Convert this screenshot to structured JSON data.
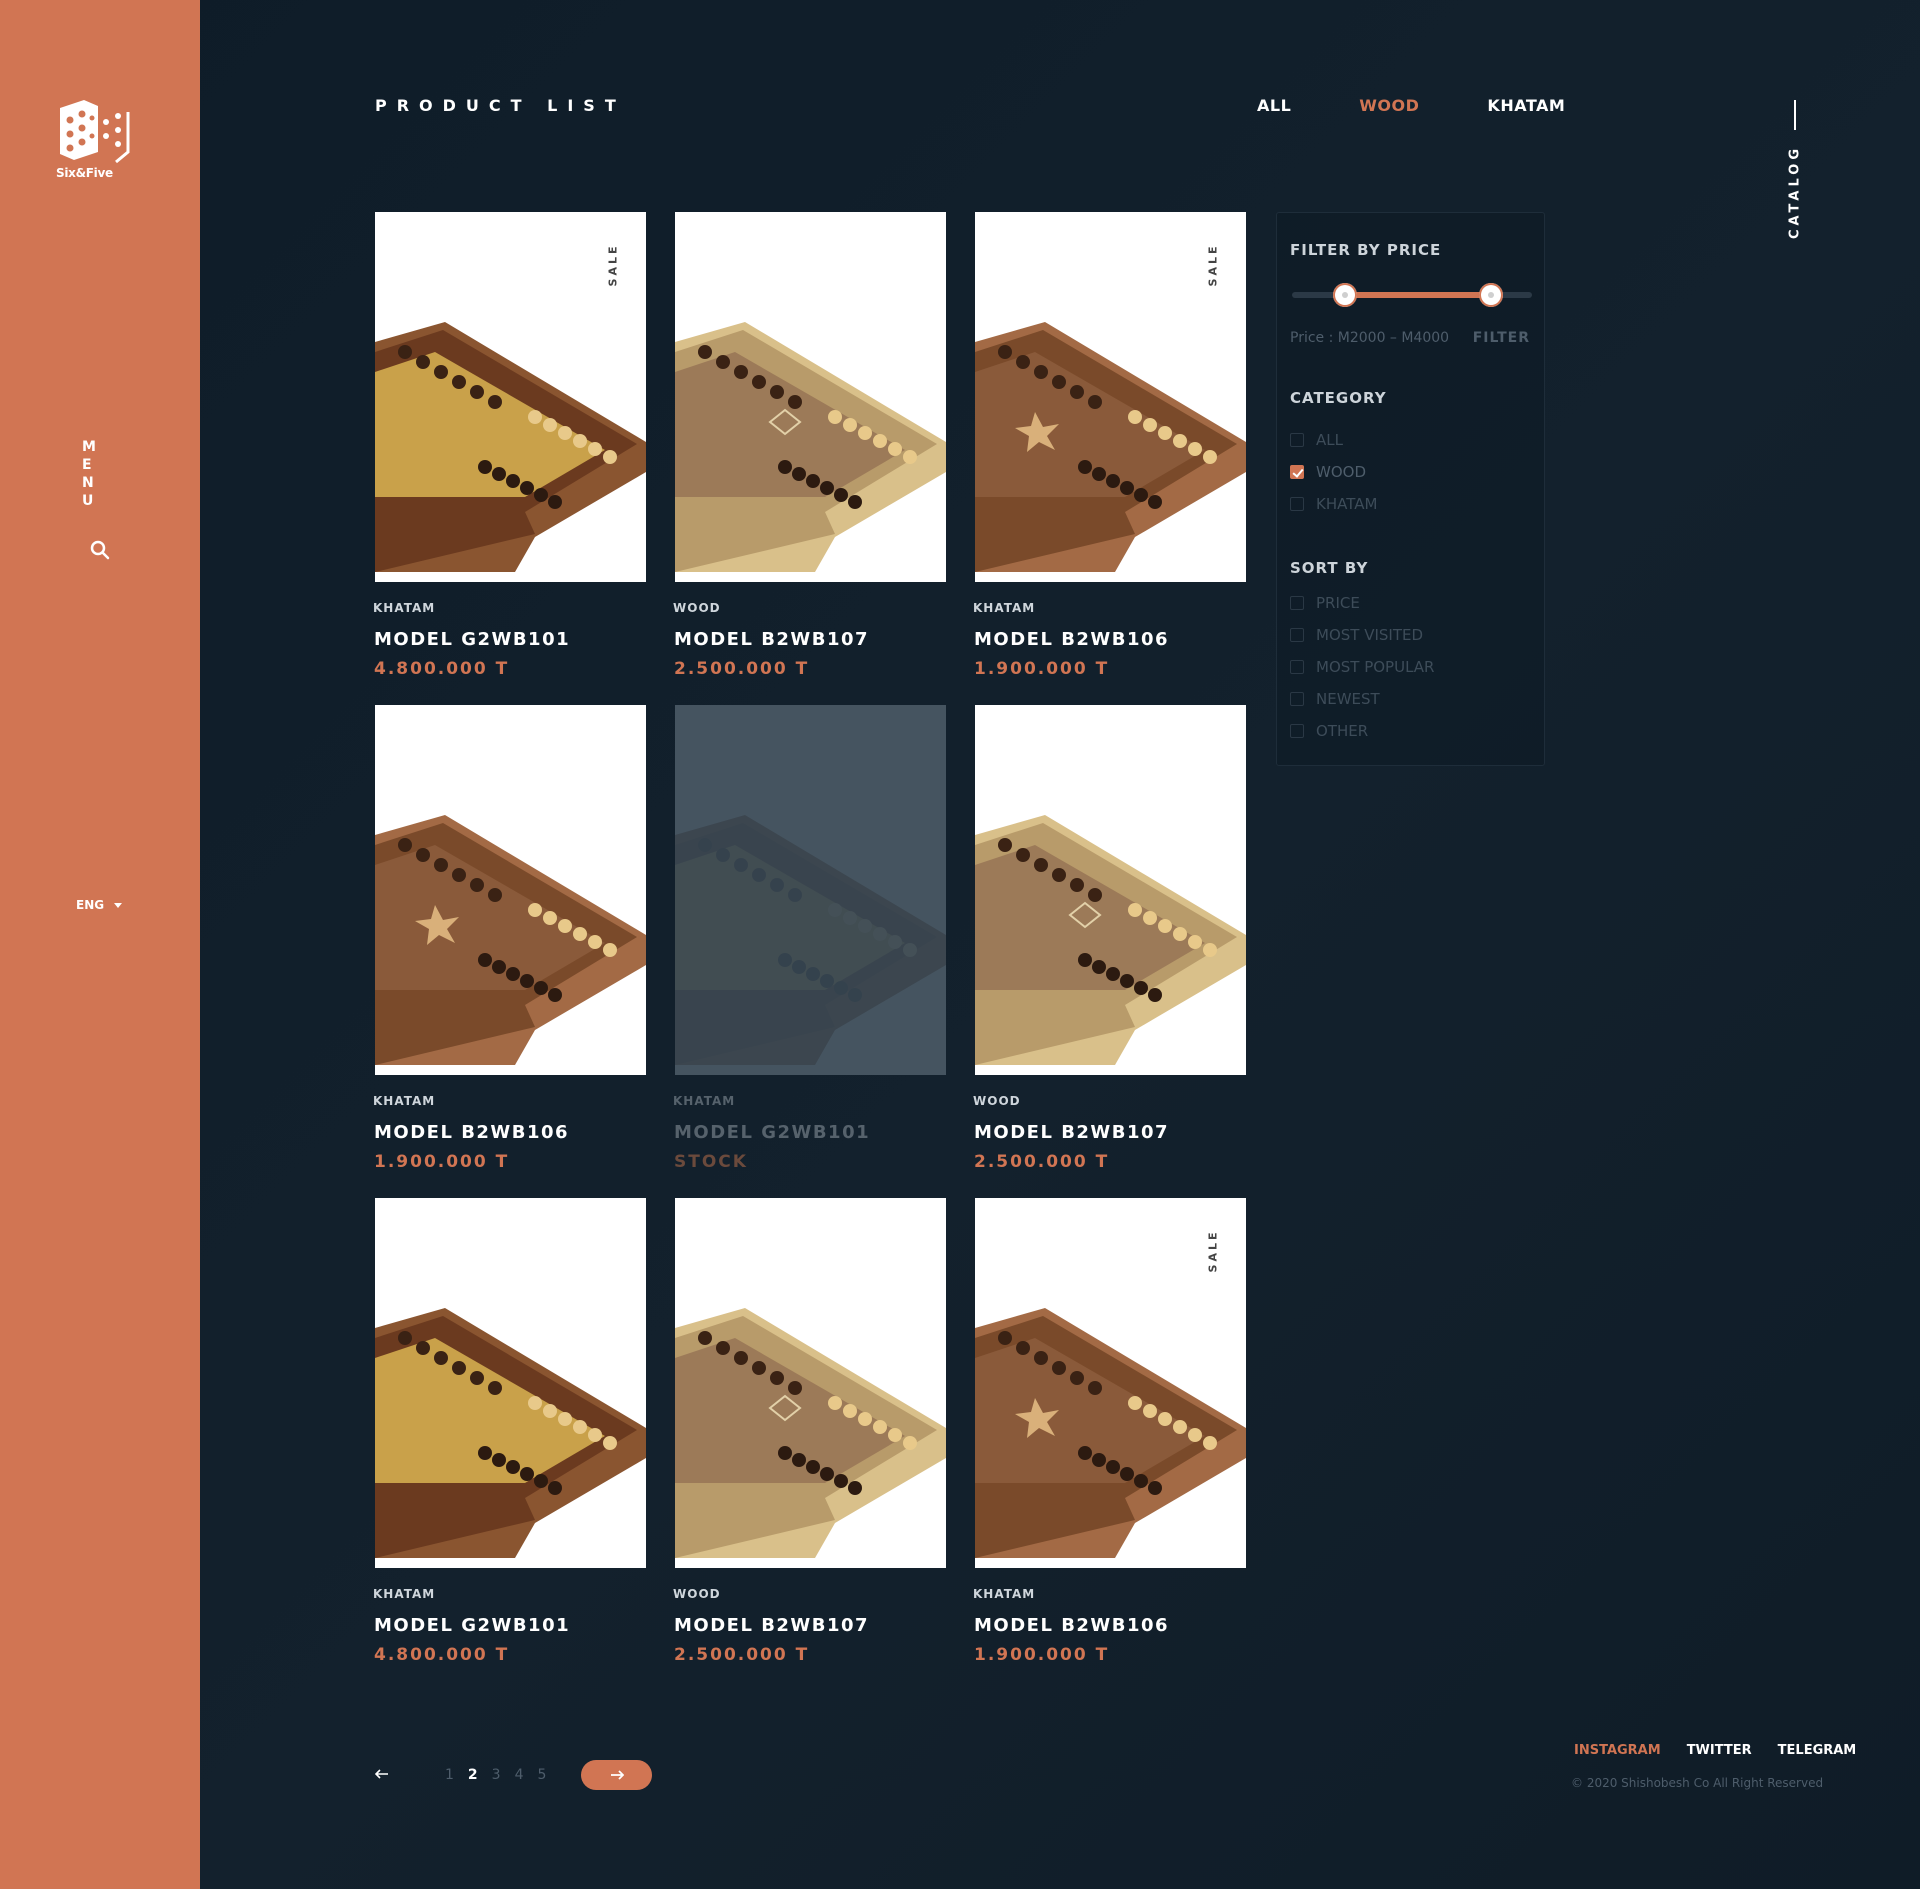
{
  "brand": {
    "logo_text": "Six&Five"
  },
  "sidebar": {
    "menu_label": "MENU",
    "search_icon": "search-icon",
    "language": "ENG"
  },
  "header": {
    "title": "PRODUCT LIST",
    "tabs": [
      {
        "label": "ALL",
        "active": false
      },
      {
        "label": "WOOD",
        "active": true
      },
      {
        "label": "KHATAM",
        "active": false
      }
    ],
    "side_label": "CATALOG"
  },
  "products": [
    {
      "category": "KHATAM",
      "name": "MODEL G2WB101",
      "price": "4.800.000 T",
      "sale": "SALE",
      "variant": "gold",
      "disabled": false
    },
    {
      "category": "WOOD",
      "name": "MODEL B2WB107",
      "price": "2.500.000 T",
      "sale": "",
      "variant": "ivory",
      "disabled": false
    },
    {
      "category": "KHATAM",
      "name": "MODEL B2WB106",
      "price": "1.900.000 T",
      "sale": "SALE",
      "variant": "star",
      "disabled": false
    },
    {
      "category": "KHATAM",
      "name": "MODEL B2WB106",
      "price": "1.900.000 T",
      "sale": "",
      "variant": "star",
      "disabled": false
    },
    {
      "category": "KHATAM",
      "name": "MODEL G2WB101",
      "price": "STOCK",
      "sale": "",
      "variant": "gold",
      "disabled": true
    },
    {
      "category": "WOOD",
      "name": "MODEL B2WB107",
      "price": "2.500.000 T",
      "sale": "",
      "variant": "ivory",
      "disabled": false
    },
    {
      "category": "KHATAM",
      "name": "MODEL G2WB101",
      "price": "4.800.000 T",
      "sale": "",
      "variant": "gold",
      "disabled": false
    },
    {
      "category": "WOOD",
      "name": "MODEL B2WB107",
      "price": "2.500.000 T",
      "sale": "",
      "variant": "ivory",
      "disabled": false
    },
    {
      "category": "KHATAM",
      "name": "MODEL B2WB106",
      "price": "1.900.000 T",
      "sale": "SALE",
      "variant": "star",
      "disabled": false
    }
  ],
  "filter": {
    "price_heading": "FILTER BY PRICE",
    "price_range_text": "Price : M2000 – M4000",
    "slider_min_fraction": 0.22,
    "slider_max_fraction": 0.83,
    "filter_button": "FILTER",
    "category_heading": "CATEGORY",
    "categories": [
      {
        "label": "ALL",
        "checked": false
      },
      {
        "label": "WOOD",
        "checked": true
      },
      {
        "label": "KHATAM",
        "checked": false
      }
    ],
    "sort_heading": "SORT BY",
    "sort_options": [
      {
        "label": "PRICE",
        "checked": false
      },
      {
        "label": "MOST VISITED",
        "checked": false
      },
      {
        "label": "MOST POPULAR",
        "checked": false
      },
      {
        "label": "NEWEST",
        "checked": false
      },
      {
        "label": "OTHER",
        "checked": false
      }
    ]
  },
  "pagination": {
    "prev_icon": "arrow-left-icon",
    "pages": [
      "1",
      "2",
      "3",
      "4",
      "5"
    ],
    "current": "2",
    "next_icon": "arrow-right-icon"
  },
  "footer": {
    "socials": [
      {
        "label": "INSTAGRAM",
        "active": true
      },
      {
        "label": "TWITTER",
        "active": false
      },
      {
        "label": "TELEGRAM",
        "active": false
      }
    ],
    "copyright": "© 2020 Shishobesh Co  All Right Reserved"
  },
  "colors": {
    "accent": "#d17553",
    "background": "#0f1d29",
    "muted": "#4e5d6b"
  }
}
